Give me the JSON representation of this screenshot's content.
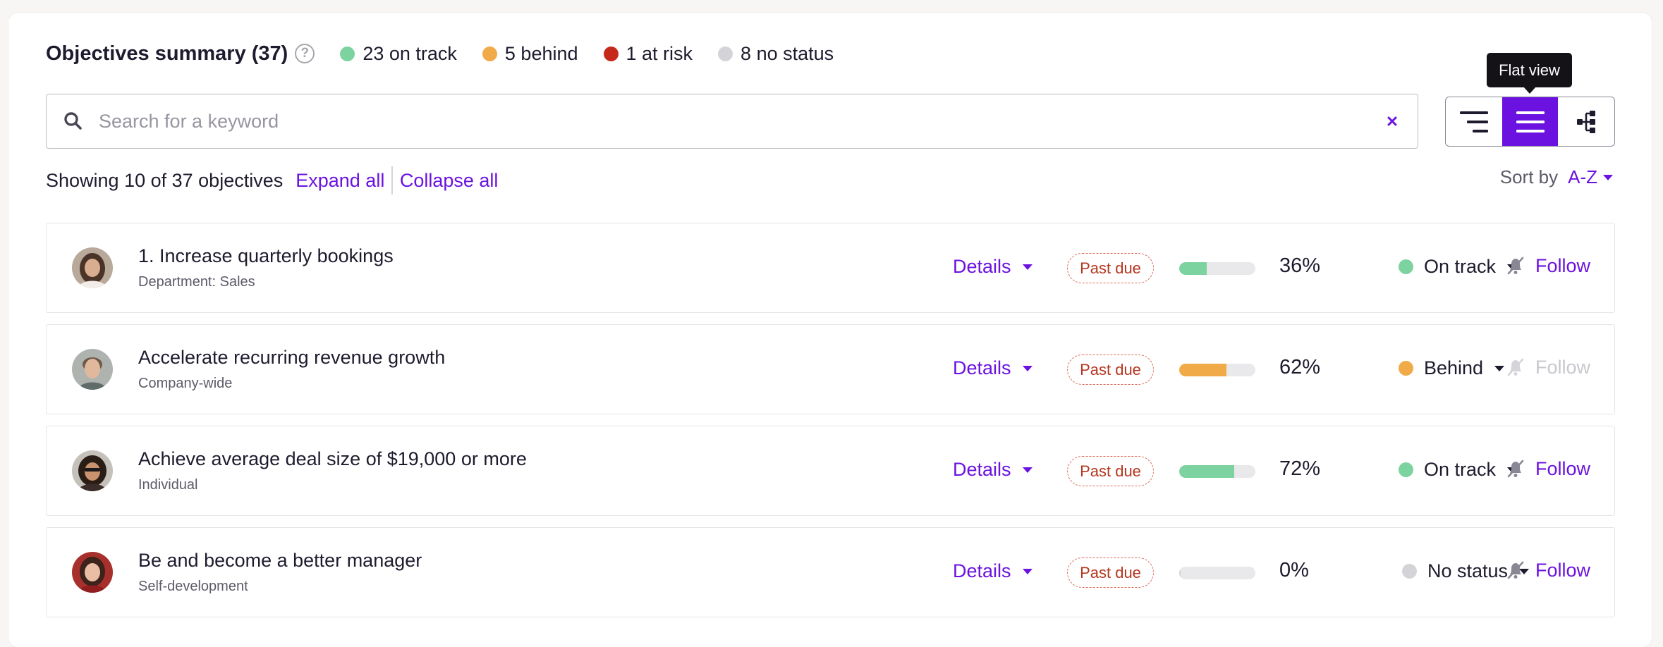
{
  "summary": {
    "title": "Objectives summary (37)",
    "help": "?",
    "counts": [
      {
        "label": "23 on track",
        "color": "#7dd3a0"
      },
      {
        "label": "5 behind",
        "color": "#f0aa48"
      },
      {
        "label": "1 at risk",
        "color": "#c4291b"
      },
      {
        "label": "8 no status",
        "color": "#d4d3d8"
      }
    ]
  },
  "search": {
    "placeholder": "Search for a keyword",
    "value": ""
  },
  "view_toggle": {
    "tooltip": "Flat view",
    "active": "flat-view"
  },
  "list_controls": {
    "showing": "Showing 10 of 37 objectives",
    "expand_all": "Expand all",
    "collapse_all": "Collapse all",
    "sort_label": "Sort by",
    "sort_value": "A-Z"
  },
  "objectives": [
    {
      "title": "1. Increase quarterly bookings",
      "subtitle": "Department: Sales",
      "details": "Details",
      "badge": "Past due",
      "progress": 36,
      "progress_label": "36%",
      "progress_color": "#7dd3a0",
      "status": "On track",
      "status_color": "#7dd3a0",
      "follow": "Follow",
      "follow_enabled": true
    },
    {
      "title": "Accelerate recurring revenue growth",
      "subtitle": "Company-wide",
      "details": "Details",
      "badge": "Past due",
      "progress": 62,
      "progress_label": "62%",
      "progress_color": "#f0aa48",
      "status": "Behind",
      "status_color": "#f0aa48",
      "follow": "Follow",
      "follow_enabled": false
    },
    {
      "title": "Achieve average deal size of $19,000 or more",
      "subtitle": "Individual",
      "details": "Details",
      "badge": "Past due",
      "progress": 72,
      "progress_label": "72%",
      "progress_color": "#7dd3a0",
      "status": "On track",
      "status_color": "#7dd3a0",
      "follow": "Follow",
      "follow_enabled": true
    },
    {
      "title": "Be and become a better manager",
      "subtitle": "Self-development",
      "details": "Details",
      "badge": "Past due",
      "progress": 0,
      "progress_label": "0%",
      "progress_color": "#d4d3d8",
      "status": "No status",
      "status_color": "#d4d3d8",
      "follow": "Follow",
      "follow_enabled": true
    }
  ],
  "colors": {
    "accent": "#6b12e0",
    "text": "#1f1b2e",
    "muted": "#5e5a68",
    "disabled": "#c9c7cd"
  }
}
